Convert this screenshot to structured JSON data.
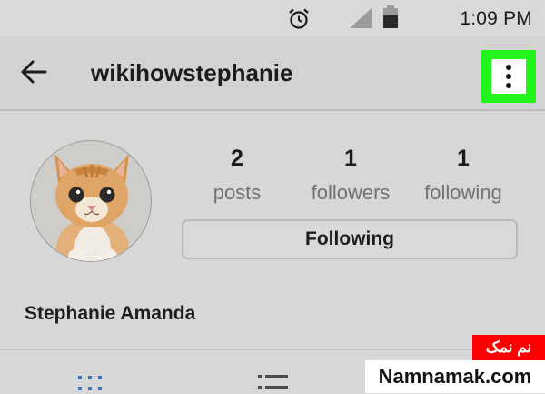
{
  "status_bar": {
    "time": "1:09 PM",
    "icons": [
      "alarm-clock-icon",
      "signal-icon",
      "battery-icon"
    ]
  },
  "app_bar": {
    "back_icon": "back-arrow-icon",
    "username": "wikihowstephanie",
    "menu_icon": "more-vertical-icon",
    "menu_highlight_color": "#22f51c"
  },
  "profile": {
    "avatar": "kitten-avatar",
    "stats": [
      {
        "count": "2",
        "label": "posts"
      },
      {
        "count": "1",
        "label": "followers"
      },
      {
        "count": "1",
        "label": "following"
      }
    ],
    "following_button_label": "Following",
    "full_name": "Stephanie Amanda"
  },
  "tabs": {
    "icons": [
      "grid-view-icon",
      "list-view-icon"
    ],
    "active_color": "#3b73c2"
  },
  "watermark": {
    "persian_text": "نم نمک",
    "site": "Namnamak.com",
    "red_color": "#ff0000"
  }
}
